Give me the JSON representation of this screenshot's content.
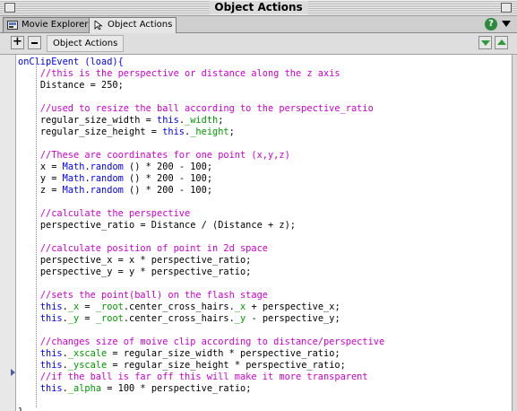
{
  "window": {
    "title": "Object Actions"
  },
  "tabs": [
    {
      "label": "Movie Explorer",
      "active": false
    },
    {
      "label": "Object Actions",
      "active": true
    }
  ],
  "toolbar": {
    "add_label": "+",
    "object_label": "Object Actions"
  },
  "help": {
    "label": "?"
  },
  "colors": {
    "keyword": "#0000ff",
    "comment": "#cc00cc",
    "property": "#009900",
    "text": "#000000"
  },
  "code_lines": [
    {
      "indent": "",
      "parts": [
        {
          "t": "onClipEvent",
          "c": "kw"
        },
        {
          "t": " (load){",
          "c": "kw"
        }
      ]
    },
    {
      "indent": "    ",
      "parts": [
        {
          "t": "//this is the perspective or distance along the z axis",
          "c": "cm"
        }
      ]
    },
    {
      "indent": "    ",
      "parts": [
        {
          "t": "Distance = 250;",
          "c": "tx"
        }
      ]
    },
    {
      "indent": "",
      "parts": []
    },
    {
      "indent": "    ",
      "parts": [
        {
          "t": "//used to resize the ball according to the perspective_ratio",
          "c": "cm"
        }
      ]
    },
    {
      "indent": "    ",
      "parts": [
        {
          "t": "regular_size_width = ",
          "c": "tx"
        },
        {
          "t": "this",
          "c": "kw"
        },
        {
          "t": ".",
          "c": "tx"
        },
        {
          "t": "_width",
          "c": "pr"
        },
        {
          "t": ";",
          "c": "tx"
        }
      ]
    },
    {
      "indent": "    ",
      "parts": [
        {
          "t": "regular_size_height = ",
          "c": "tx"
        },
        {
          "t": "this",
          "c": "kw"
        },
        {
          "t": ".",
          "c": "tx"
        },
        {
          "t": "_height",
          "c": "pr"
        },
        {
          "t": ";",
          "c": "tx"
        }
      ]
    },
    {
      "indent": "",
      "parts": []
    },
    {
      "indent": "    ",
      "parts": [
        {
          "t": "//These are coordinates for one point (x,y,z)",
          "c": "cm"
        }
      ]
    },
    {
      "indent": "    ",
      "parts": [
        {
          "t": "x = ",
          "c": "tx"
        },
        {
          "t": "Math",
          "c": "kw"
        },
        {
          "t": ".",
          "c": "tx"
        },
        {
          "t": "random",
          "c": "kw"
        },
        {
          "t": " () * 200 - 100;",
          "c": "tx"
        }
      ]
    },
    {
      "indent": "    ",
      "parts": [
        {
          "t": "y = ",
          "c": "tx"
        },
        {
          "t": "Math",
          "c": "kw"
        },
        {
          "t": ".",
          "c": "tx"
        },
        {
          "t": "random",
          "c": "kw"
        },
        {
          "t": " () * 200 - 100;",
          "c": "tx"
        }
      ]
    },
    {
      "indent": "    ",
      "parts": [
        {
          "t": "z = ",
          "c": "tx"
        },
        {
          "t": "Math",
          "c": "kw"
        },
        {
          "t": ".",
          "c": "tx"
        },
        {
          "t": "random",
          "c": "kw"
        },
        {
          "t": " () * 200 - 100;",
          "c": "tx"
        }
      ]
    },
    {
      "indent": "",
      "parts": []
    },
    {
      "indent": "    ",
      "parts": [
        {
          "t": "//calculate the perspective",
          "c": "cm"
        }
      ]
    },
    {
      "indent": "    ",
      "parts": [
        {
          "t": "perspective_ratio = Distance / (Distance + z);",
          "c": "tx"
        }
      ]
    },
    {
      "indent": "",
      "parts": []
    },
    {
      "indent": "    ",
      "parts": [
        {
          "t": "//calculate position of point in 2d space",
          "c": "cm"
        }
      ]
    },
    {
      "indent": "    ",
      "parts": [
        {
          "t": "perspective_x = x * perspective_ratio;",
          "c": "tx"
        }
      ]
    },
    {
      "indent": "    ",
      "parts": [
        {
          "t": "perspective_y = y * perspective_ratio;",
          "c": "tx"
        }
      ]
    },
    {
      "indent": "",
      "parts": []
    },
    {
      "indent": "    ",
      "parts": [
        {
          "t": "//sets the point(ball) on the flash stage",
          "c": "cm"
        }
      ]
    },
    {
      "indent": "    ",
      "parts": [
        {
          "t": "this",
          "c": "kw"
        },
        {
          "t": ".",
          "c": "tx"
        },
        {
          "t": "_x",
          "c": "pr"
        },
        {
          "t": " = ",
          "c": "tx"
        },
        {
          "t": "_root",
          "c": "pr"
        },
        {
          "t": ".center_cross_hairs.",
          "c": "tx"
        },
        {
          "t": "_x",
          "c": "pr"
        },
        {
          "t": " + perspective_x;",
          "c": "tx"
        }
      ]
    },
    {
      "indent": "    ",
      "parts": [
        {
          "t": "this",
          "c": "kw"
        },
        {
          "t": ".",
          "c": "tx"
        },
        {
          "t": "_y",
          "c": "pr"
        },
        {
          "t": " = ",
          "c": "tx"
        },
        {
          "t": "_root",
          "c": "pr"
        },
        {
          "t": ".center_cross_hairs.",
          "c": "tx"
        },
        {
          "t": "_y",
          "c": "pr"
        },
        {
          "t": " - perspective_y;",
          "c": "tx"
        }
      ]
    },
    {
      "indent": "",
      "parts": []
    },
    {
      "indent": "    ",
      "parts": [
        {
          "t": "//changes size of moive clip according to distance/perspective",
          "c": "cm"
        }
      ]
    },
    {
      "indent": "    ",
      "parts": [
        {
          "t": "this",
          "c": "kw"
        },
        {
          "t": ".",
          "c": "tx"
        },
        {
          "t": "_xscale",
          "c": "pr"
        },
        {
          "t": " = regular_size_width * perspective_ratio;",
          "c": "tx"
        }
      ]
    },
    {
      "indent": "    ",
      "parts": [
        {
          "t": "this",
          "c": "kw"
        },
        {
          "t": ".",
          "c": "tx"
        },
        {
          "t": "_yscale",
          "c": "pr"
        },
        {
          "t": " = regular_size_height * perspective_ratio;",
          "c": "tx"
        }
      ]
    },
    {
      "indent": "    ",
      "parts": [
        {
          "t": "//if the ball is far off this will make it more transparent",
          "c": "cm"
        }
      ]
    },
    {
      "indent": "    ",
      "parts": [
        {
          "t": "this",
          "c": "kw"
        },
        {
          "t": ".",
          "c": "tx"
        },
        {
          "t": "_alpha",
          "c": "pr"
        },
        {
          "t": " = 100 * perspective_ratio;",
          "c": "tx"
        }
      ]
    },
    {
      "indent": "",
      "parts": []
    },
    {
      "indent": "",
      "parts": [
        {
          "t": "}",
          "c": "tx"
        }
      ]
    }
  ]
}
